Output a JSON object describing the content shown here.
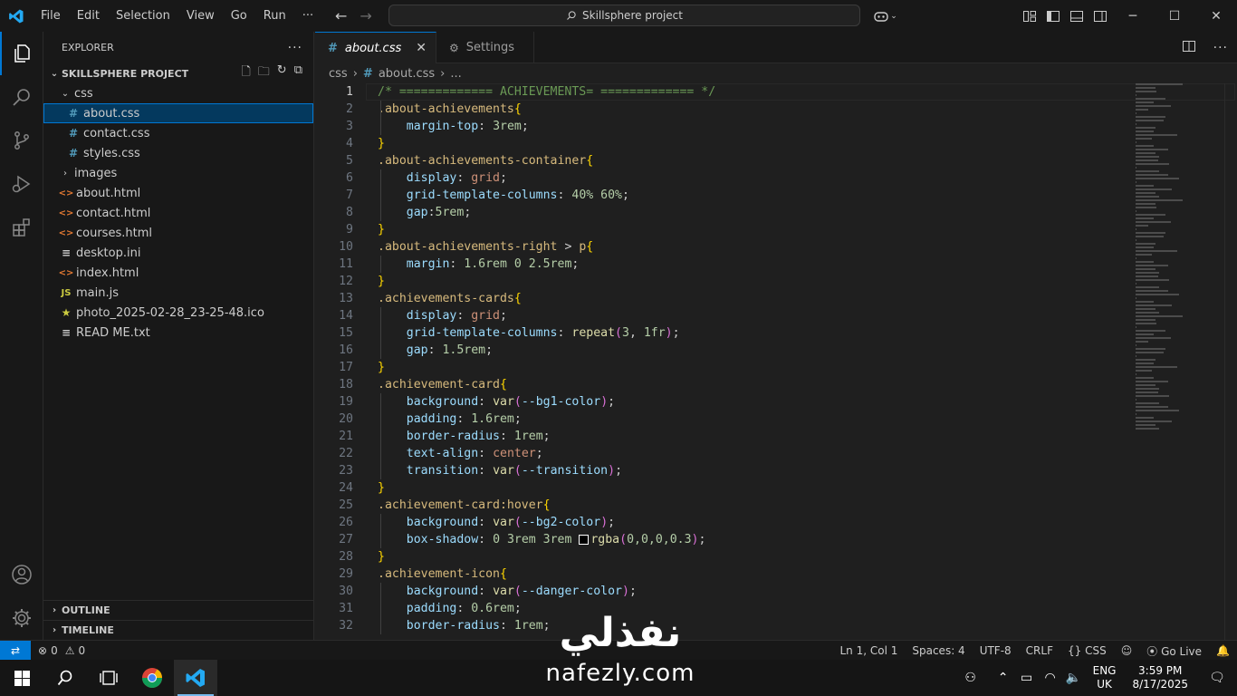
{
  "titlebar": {
    "menu": [
      "File",
      "Edit",
      "Selection",
      "View",
      "Go",
      "Run",
      "···"
    ],
    "command_center": "Skillsphere project"
  },
  "sidebar": {
    "header": "EXPLORER",
    "project": "SKILLSPHERE PROJECT",
    "tree": [
      {
        "label": "css",
        "type": "folder",
        "open": true,
        "depth": 1
      },
      {
        "label": "about.css",
        "type": "css",
        "depth": 2,
        "selected": true
      },
      {
        "label": "contact.css",
        "type": "css",
        "depth": 2
      },
      {
        "label": "styles.css",
        "type": "css",
        "depth": 2
      },
      {
        "label": "images",
        "type": "folder",
        "open": false,
        "depth": 1
      },
      {
        "label": "about.html",
        "type": "html",
        "depth": 1
      },
      {
        "label": "contact.html",
        "type": "html",
        "depth": 1
      },
      {
        "label": "courses.html",
        "type": "html",
        "depth": 1
      },
      {
        "label": "desktop.ini",
        "type": "ini",
        "depth": 1
      },
      {
        "label": "index.html",
        "type": "html",
        "depth": 1
      },
      {
        "label": "main.js",
        "type": "js",
        "depth": 1
      },
      {
        "label": "photo_2025-02-28_23-25-48.ico",
        "type": "star",
        "depth": 1
      },
      {
        "label": "READ ME.txt",
        "type": "ini",
        "depth": 1
      }
    ],
    "outline": "OUTLINE",
    "timeline": "TIMELINE"
  },
  "tabs": {
    "active": "about.css",
    "settings": "Settings"
  },
  "breadcrumb": {
    "folder": "css",
    "file": "about.css",
    "more": "..."
  },
  "code": [
    [
      [
        "c-com",
        "/* ============= ACHIEVEMENTS= ============= */"
      ]
    ],
    [
      [
        "c-sel",
        ".about-achievements"
      ],
      [
        "c-br",
        "{"
      ]
    ],
    [
      [
        "t",
        "    "
      ],
      [
        "c-prop",
        "margin-top"
      ],
      [
        "c-pn",
        ": "
      ],
      [
        "c-num",
        "3rem"
      ],
      [
        "c-pn",
        ";"
      ]
    ],
    [
      [
        "c-br",
        "}"
      ]
    ],
    [
      [
        "c-sel",
        ".about-achievements-container"
      ],
      [
        "c-br",
        "{"
      ]
    ],
    [
      [
        "t",
        "    "
      ],
      [
        "c-prop",
        "display"
      ],
      [
        "c-pn",
        ": "
      ],
      [
        "c-val",
        "grid"
      ],
      [
        "c-pn",
        ";"
      ]
    ],
    [
      [
        "t",
        "    "
      ],
      [
        "c-prop",
        "grid-template-columns"
      ],
      [
        "c-pn",
        ": "
      ],
      [
        "c-num",
        "40% 60%"
      ],
      [
        "c-pn",
        ";"
      ]
    ],
    [
      [
        "t",
        "    "
      ],
      [
        "c-prop",
        "gap"
      ],
      [
        "c-pn",
        ":"
      ],
      [
        "c-num",
        "5rem"
      ],
      [
        "c-pn",
        ";"
      ]
    ],
    [
      [
        "c-br",
        "}"
      ]
    ],
    [
      [
        "c-sel",
        ".about-achievements-right"
      ],
      [
        "c-pn",
        " > "
      ],
      [
        "c-sel",
        "p"
      ],
      [
        "c-br",
        "{"
      ]
    ],
    [
      [
        "t",
        "    "
      ],
      [
        "c-prop",
        "margin"
      ],
      [
        "c-pn",
        ": "
      ],
      [
        "c-num",
        "1.6rem 0 2.5rem"
      ],
      [
        "c-pn",
        ";"
      ]
    ],
    [
      [
        "c-br",
        "}"
      ]
    ],
    [
      [
        "c-sel",
        ".achievements-cards"
      ],
      [
        "c-br",
        "{"
      ]
    ],
    [
      [
        "t",
        "    "
      ],
      [
        "c-prop",
        "display"
      ],
      [
        "c-pn",
        ": "
      ],
      [
        "c-val",
        "grid"
      ],
      [
        "c-pn",
        ";"
      ]
    ],
    [
      [
        "t",
        "    "
      ],
      [
        "c-prop",
        "grid-template-columns"
      ],
      [
        "c-pn",
        ": "
      ],
      [
        "c-fn",
        "repeat"
      ],
      [
        "c-pb",
        "("
      ],
      [
        "c-num",
        "3"
      ],
      [
        "c-pn",
        ", "
      ],
      [
        "c-num",
        "1fr"
      ],
      [
        "c-pb",
        ")"
      ],
      [
        "c-pn",
        ";"
      ]
    ],
    [
      [
        "t",
        "    "
      ],
      [
        "c-prop",
        "gap"
      ],
      [
        "c-pn",
        ": "
      ],
      [
        "c-num",
        "1.5rem"
      ],
      [
        "c-pn",
        ";"
      ]
    ],
    [
      [
        "c-br",
        "}"
      ]
    ],
    [
      [
        "c-sel",
        ".achievement-card"
      ],
      [
        "c-br",
        "{"
      ]
    ],
    [
      [
        "t",
        "    "
      ],
      [
        "c-prop",
        "background"
      ],
      [
        "c-pn",
        ": "
      ],
      [
        "c-fn",
        "var"
      ],
      [
        "c-pb",
        "("
      ],
      [
        "c-var",
        "--bg1-color"
      ],
      [
        "c-pb",
        ")"
      ],
      [
        "c-pn",
        ";"
      ]
    ],
    [
      [
        "t",
        "    "
      ],
      [
        "c-prop",
        "padding"
      ],
      [
        "c-pn",
        ": "
      ],
      [
        "c-num",
        "1.6rem"
      ],
      [
        "c-pn",
        ";"
      ]
    ],
    [
      [
        "t",
        "    "
      ],
      [
        "c-prop",
        "border-radius"
      ],
      [
        "c-pn",
        ": "
      ],
      [
        "c-num",
        "1rem"
      ],
      [
        "c-pn",
        ";"
      ]
    ],
    [
      [
        "t",
        "    "
      ],
      [
        "c-prop",
        "text-align"
      ],
      [
        "c-pn",
        ": "
      ],
      [
        "c-val",
        "center"
      ],
      [
        "c-pn",
        ";"
      ]
    ],
    [
      [
        "t",
        "    "
      ],
      [
        "c-prop",
        "transition"
      ],
      [
        "c-pn",
        ": "
      ],
      [
        "c-fn",
        "var"
      ],
      [
        "c-pb",
        "("
      ],
      [
        "c-var",
        "--transition"
      ],
      [
        "c-pb",
        ")"
      ],
      [
        "c-pn",
        ";"
      ]
    ],
    [
      [
        "c-br",
        "}"
      ]
    ],
    [
      [
        "c-sel",
        ".achievement-card:hover"
      ],
      [
        "c-br",
        "{"
      ]
    ],
    [
      [
        "t",
        "    "
      ],
      [
        "c-prop",
        "background"
      ],
      [
        "c-pn",
        ": "
      ],
      [
        "c-fn",
        "var"
      ],
      [
        "c-pb",
        "("
      ],
      [
        "c-var",
        "--bg2-color"
      ],
      [
        "c-pb",
        ")"
      ],
      [
        "c-pn",
        ";"
      ]
    ],
    [
      [
        "t",
        "    "
      ],
      [
        "c-prop",
        "box-shadow"
      ],
      [
        "c-pn",
        ": "
      ],
      [
        "c-num",
        "0 3rem 3rem "
      ],
      [
        "sw",
        ""
      ],
      [
        "c-fn",
        "rgba"
      ],
      [
        "c-pb",
        "("
      ],
      [
        "c-num",
        "0,0,0,0.3"
      ],
      [
        "c-pb",
        ")"
      ],
      [
        "c-pn",
        ";"
      ]
    ],
    [
      [
        "c-br",
        "}"
      ]
    ],
    [
      [
        "c-sel",
        ".achievement-icon"
      ],
      [
        "c-br",
        "{"
      ]
    ],
    [
      [
        "t",
        "    "
      ],
      [
        "c-prop",
        "background"
      ],
      [
        "c-pn",
        ": "
      ],
      [
        "c-fn",
        "var"
      ],
      [
        "c-pb",
        "("
      ],
      [
        "c-var",
        "--danger-color"
      ],
      [
        "c-pb",
        ")"
      ],
      [
        "c-pn",
        ";"
      ]
    ],
    [
      [
        "t",
        "    "
      ],
      [
        "c-prop",
        "padding"
      ],
      [
        "c-pn",
        ": "
      ],
      [
        "c-num",
        "0.6rem"
      ],
      [
        "c-pn",
        ";"
      ]
    ],
    [
      [
        "t",
        "    "
      ],
      [
        "c-prop",
        "border-radius"
      ],
      [
        "c-pn",
        ": "
      ],
      [
        "c-num",
        "1rem"
      ],
      [
        "c-pn",
        ";"
      ]
    ]
  ],
  "statusbar": {
    "errors": "0",
    "warnings": "0",
    "position": "Ln 1, Col 1",
    "spaces": "Spaces: 4",
    "encoding": "UTF-8",
    "eol": "CRLF",
    "language": "CSS",
    "golive": "Go Live"
  },
  "taskbar": {
    "lang1": "ENG",
    "lang2": "UK",
    "time": "3:59 PM",
    "date": "8/17/2025"
  },
  "watermark": {
    "arabic": "نفذلي",
    "latin": "nafezly.com"
  },
  "colors": {
    "accent": "#0078d4",
    "css_icon": "#519aba",
    "html_icon": "#e37933"
  }
}
